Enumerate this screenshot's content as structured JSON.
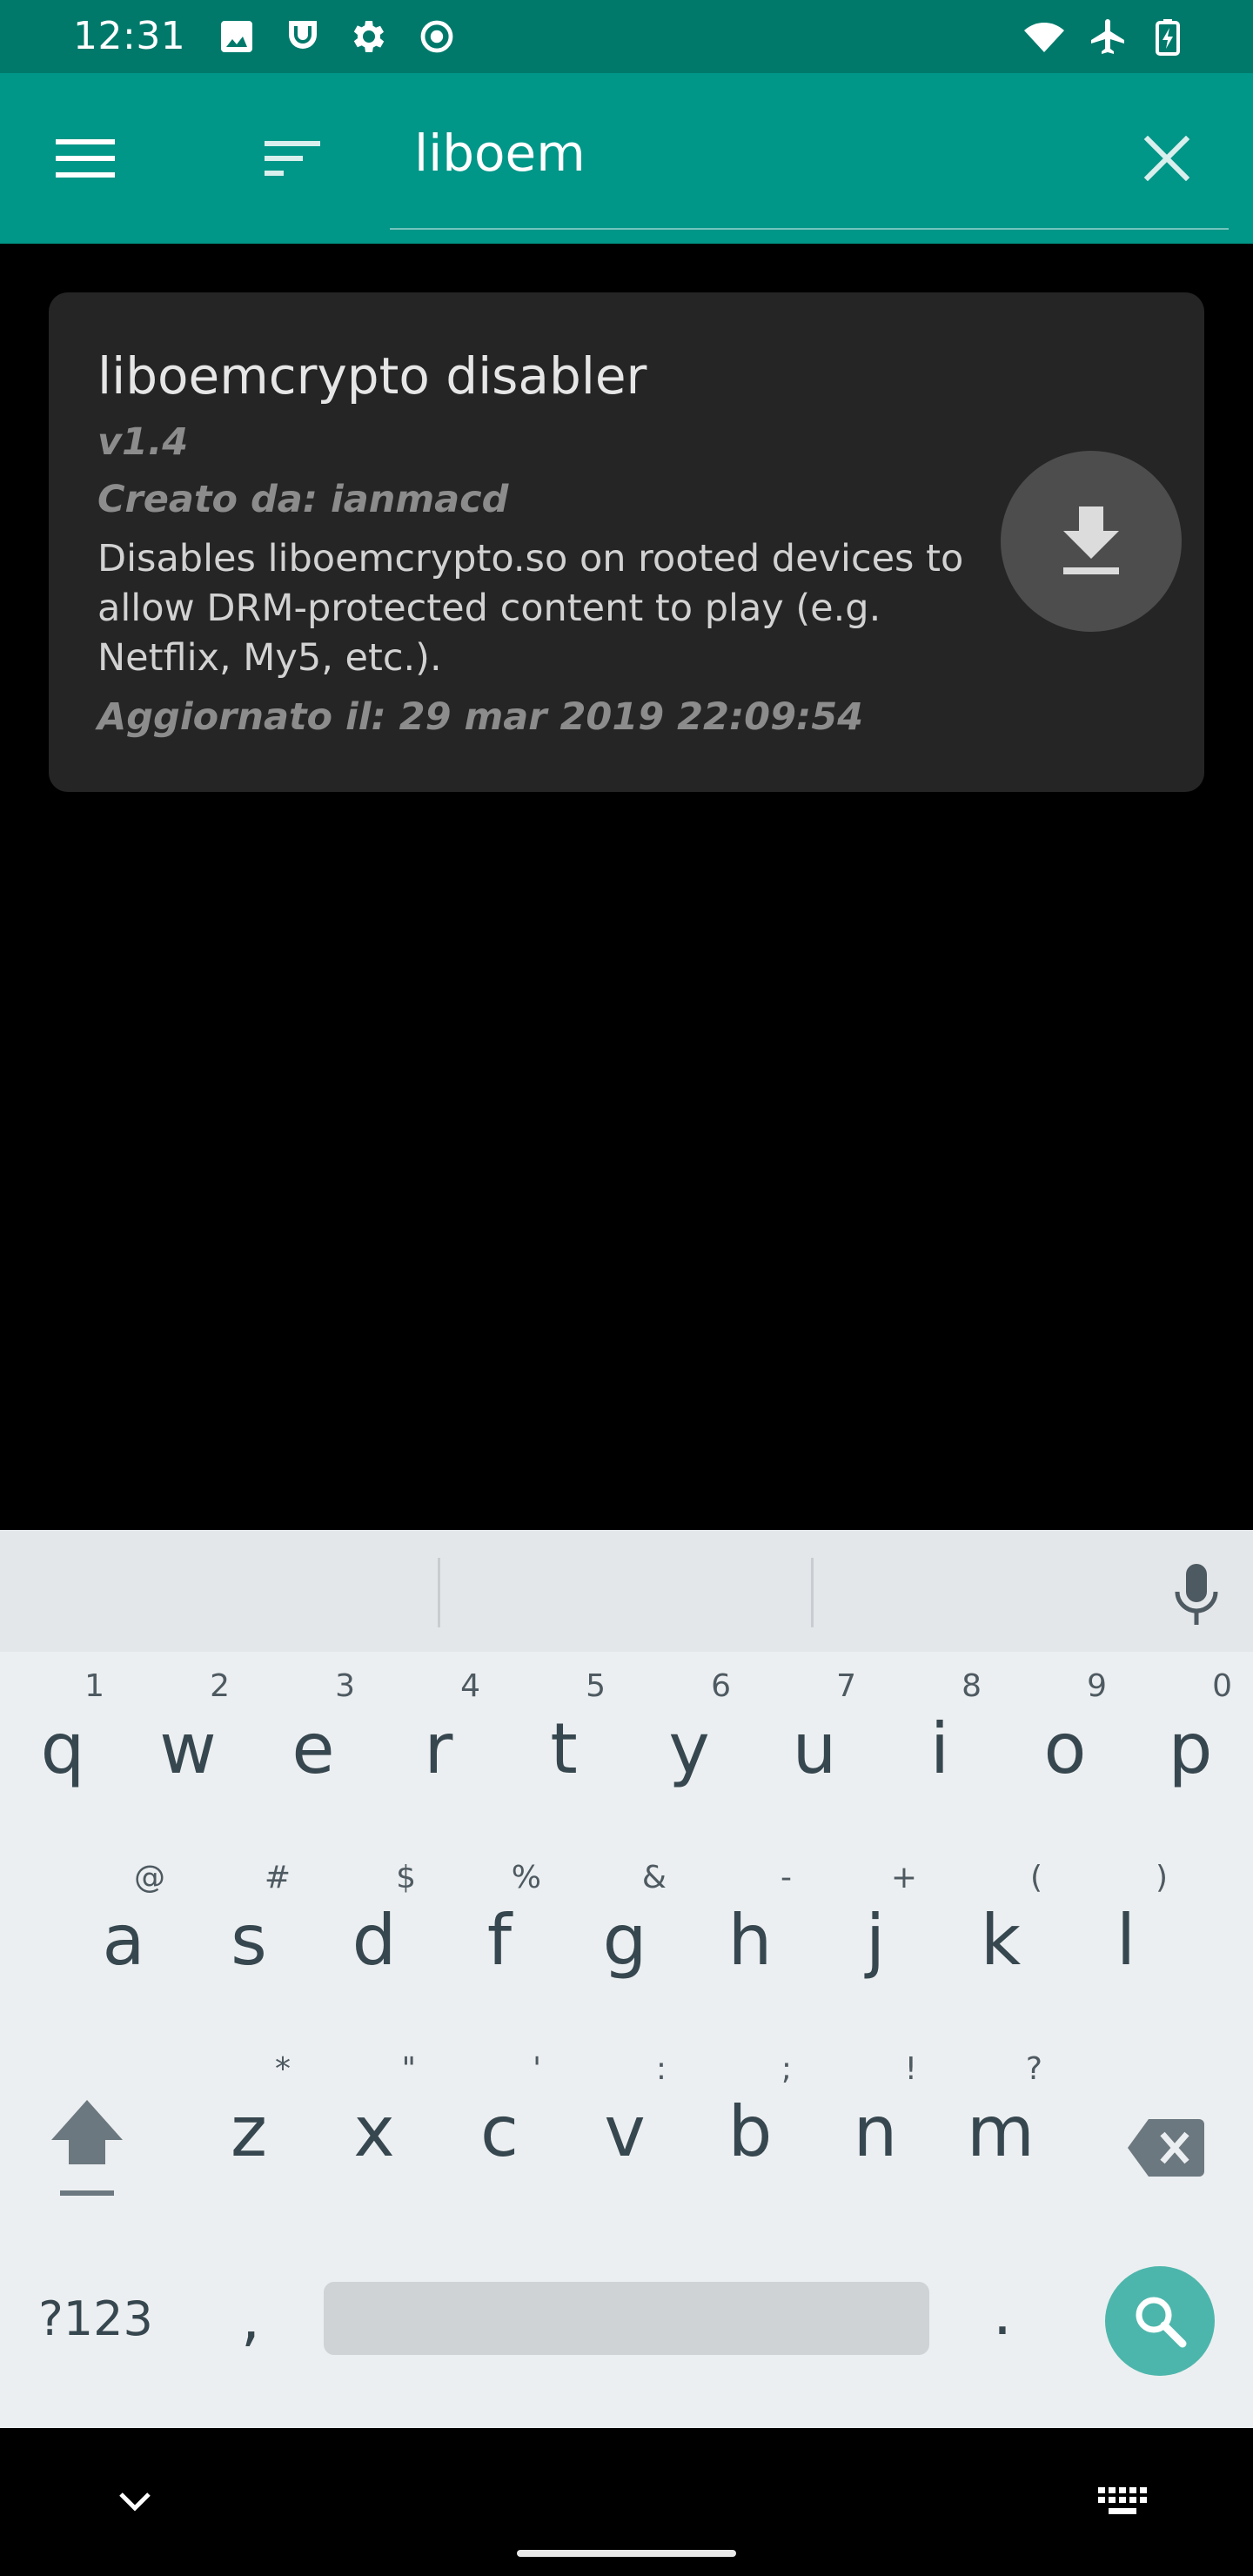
{
  "status_bar": {
    "time": "12:31",
    "left_icons": [
      "image-icon",
      "shield-face-icon",
      "gear-icon",
      "record-icon"
    ],
    "right_icons": [
      "wifi-icon",
      "airplane-icon",
      "battery-charging-icon"
    ]
  },
  "app_bar": {
    "background": "#009688",
    "search_value": "liboem",
    "icons": [
      "menu-icon",
      "sort-icon",
      "close-icon"
    ]
  },
  "result_card": {
    "title": "liboemcrypto disabler",
    "version": "v1.4",
    "author": "Creato da: ianmacd",
    "description": "Disables liboemcrypto.so on rooted devices to allow DRM-protected content to play (e.g. Netflix, My5, etc.).",
    "updated": "Aggiornato il: 29 mar 2019 22:09:54",
    "action_icon": "download-icon"
  },
  "keyboard": {
    "accent": "#4DB6AC",
    "row1": [
      {
        "k": "q",
        "h": "1"
      },
      {
        "k": "w",
        "h": "2"
      },
      {
        "k": "e",
        "h": "3"
      },
      {
        "k": "r",
        "h": "4"
      },
      {
        "k": "t",
        "h": "5"
      },
      {
        "k": "y",
        "h": "6"
      },
      {
        "k": "u",
        "h": "7"
      },
      {
        "k": "i",
        "h": "8"
      },
      {
        "k": "o",
        "h": "9"
      },
      {
        "k": "p",
        "h": "0"
      }
    ],
    "row2": [
      {
        "k": "a",
        "h": "@"
      },
      {
        "k": "s",
        "h": "#"
      },
      {
        "k": "d",
        "h": "$"
      },
      {
        "k": "f",
        "h": "%"
      },
      {
        "k": "g",
        "h": "&"
      },
      {
        "k": "h",
        "h": "-"
      },
      {
        "k": "j",
        "h": "+"
      },
      {
        "k": "k",
        "h": "("
      },
      {
        "k": "l",
        "h": ")"
      }
    ],
    "row3": [
      {
        "k": "z",
        "h": "*"
      },
      {
        "k": "x",
        "h": "\""
      },
      {
        "k": "c",
        "h": "'"
      },
      {
        "k": "v",
        "h": ":"
      },
      {
        "k": "b",
        "h": ";"
      },
      {
        "k": "n",
        "h": "!"
      },
      {
        "k": "m",
        "h": "?"
      }
    ],
    "symbols_label": "?123",
    "comma": ",",
    "period": ".",
    "icons": [
      "mic-icon",
      "shift-icon",
      "backspace-icon",
      "search-icon"
    ]
  },
  "nav_bar": {
    "icons": [
      "chevron-down-icon",
      "keyboard-icon"
    ]
  }
}
